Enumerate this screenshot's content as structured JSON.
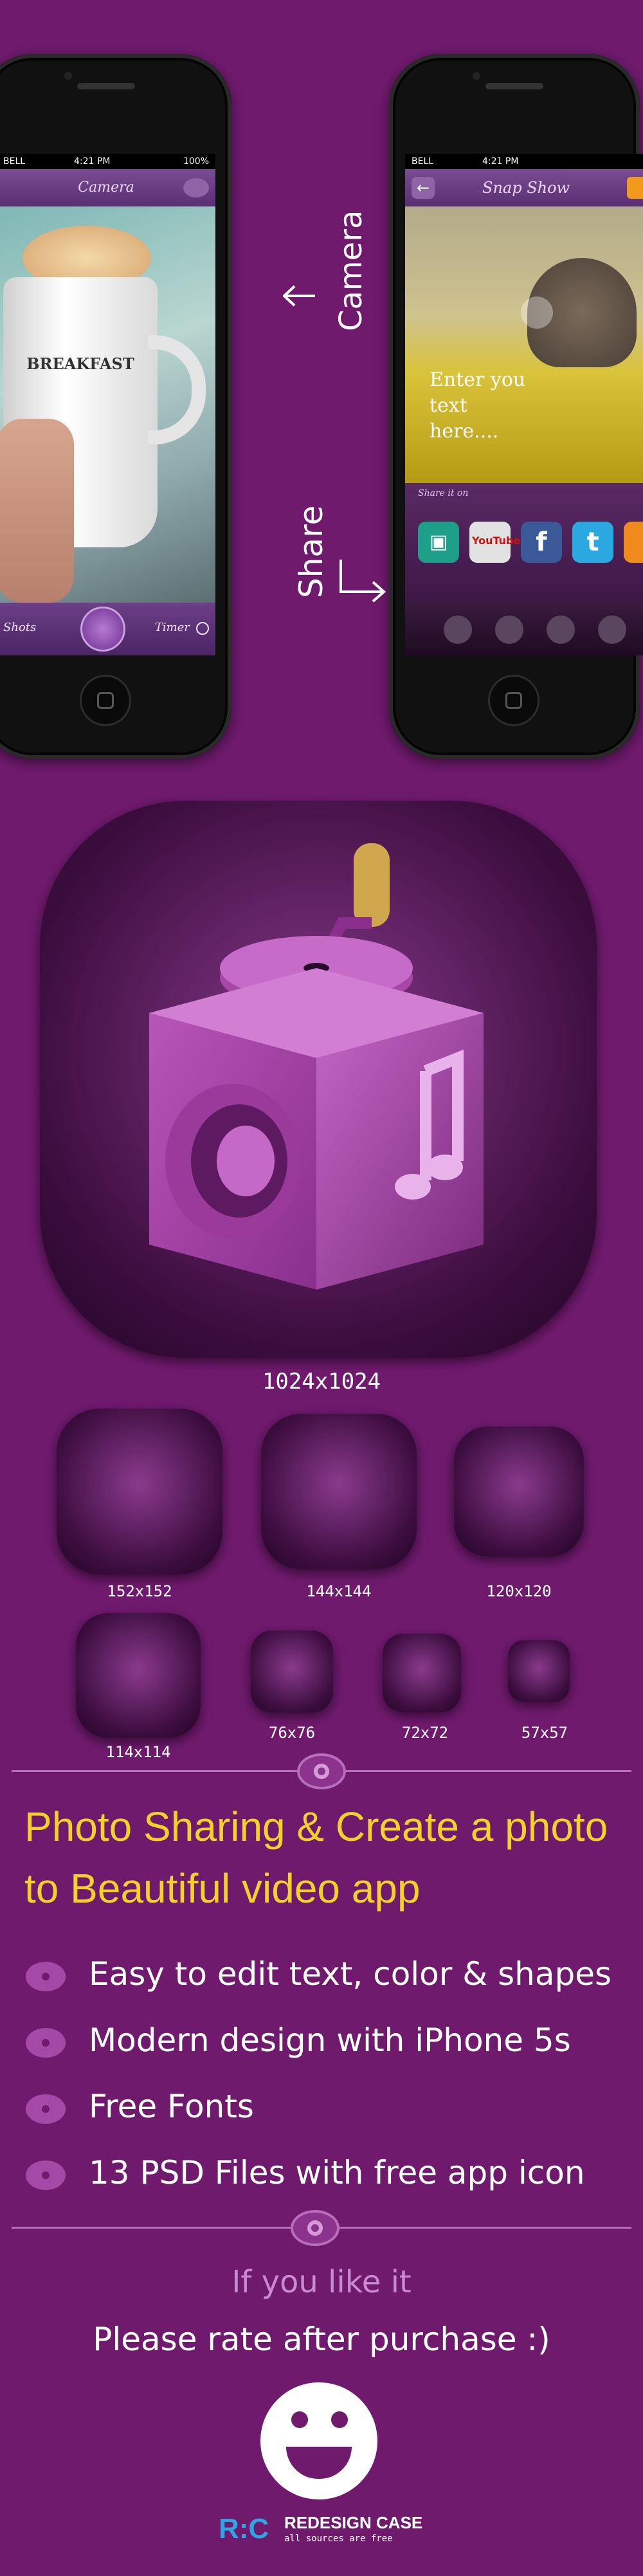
{
  "left_phone": {
    "status_carrier": "BELL",
    "status_time": "4:21 PM",
    "status_battery": "100%",
    "nav_title": "Camera",
    "mug_text": "BREAKFAST",
    "toolbar_left": "Shots",
    "toolbar_right": "Timer"
  },
  "right_phone": {
    "status_carrier": "BELL",
    "status_time": "4:21 PM",
    "nav_title": "Snap Show",
    "overlay_text": "Enter you text here....",
    "share_label": "Share it on",
    "social": [
      "save",
      "YouTube",
      "f",
      "t"
    ]
  },
  "callouts": {
    "camera": "Camera",
    "share": "Share"
  },
  "icons": {
    "main_size": "1024x1024",
    "sizes": [
      "152x152",
      "144x144",
      "120x120",
      "114x114",
      "76x76",
      "72x72",
      "57x57"
    ]
  },
  "headline": "Photo Sharing & Create a photo to Beautiful video app",
  "headline_line1": "Photo Sharing & Create a photo",
  "headline_line2": "to Beautiful video app",
  "features": [
    "Easy to edit text, color & shapes",
    "Modern design with iPhone 5s",
    "Free Fonts",
    "13 PSD Files with free app icon"
  ],
  "footer": {
    "if_you_like": "If you like it",
    "please_rate": "Please rate after purchase :)",
    "brand_logo": "R:C",
    "brand_name": "REDESIGN CASE",
    "brand_tagline": "all sources are free"
  },
  "colors": {
    "background": "#701a6e",
    "headline": "#f2d22a",
    "accent_purple": "#a44aa6"
  }
}
